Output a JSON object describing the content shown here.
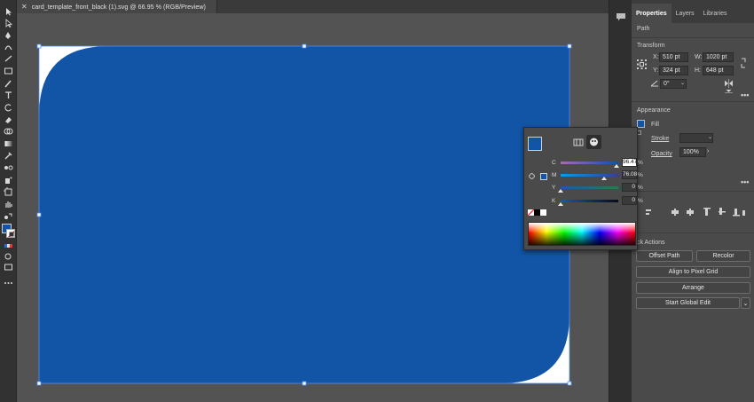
{
  "document": {
    "tab_title": "card_template_front_black (1).svg @ 66.95 % (RGB/Preview)",
    "fill_color": "#1254a6",
    "artboard_color": "#ffffff",
    "selection_color": "#4a90ff"
  },
  "panel": {
    "tabs": [
      "Properties",
      "Layers",
      "Libraries"
    ],
    "active_tab": "Properties",
    "object_type": "Path",
    "transform": {
      "title": "Transform",
      "x_label": "X:",
      "x_value": "510 pt",
      "y_label": "Y:",
      "y_value": "324 pt",
      "w_label": "W:",
      "w_value": "1020 pt",
      "h_label": "H:",
      "h_value": "648 pt",
      "angle_value": "0°"
    },
    "appearance": {
      "title": "Appearance",
      "fill_label": "Fill",
      "stroke_label": "Stroke",
      "opacity_label": "Opacity",
      "opacity_value": "100%"
    },
    "quick_actions": {
      "title_visible": "ck Actions",
      "offset_path": "Offset Path",
      "recolor": "Recolor",
      "align_pixel": "Align to Pixel Grid",
      "arrange": "Arrange",
      "global_edit": "Start Global Edit"
    }
  },
  "color_popover": {
    "channels": [
      {
        "label": "C",
        "value": "96.47",
        "fraction": 0.9647
      },
      {
        "label": "M",
        "value": "76.08",
        "fraction": 0.7608
      },
      {
        "label": "Y",
        "value": "0",
        "fraction": 0
      },
      {
        "label": "K",
        "value": "0",
        "fraction": 0
      }
    ],
    "percent": "%"
  }
}
